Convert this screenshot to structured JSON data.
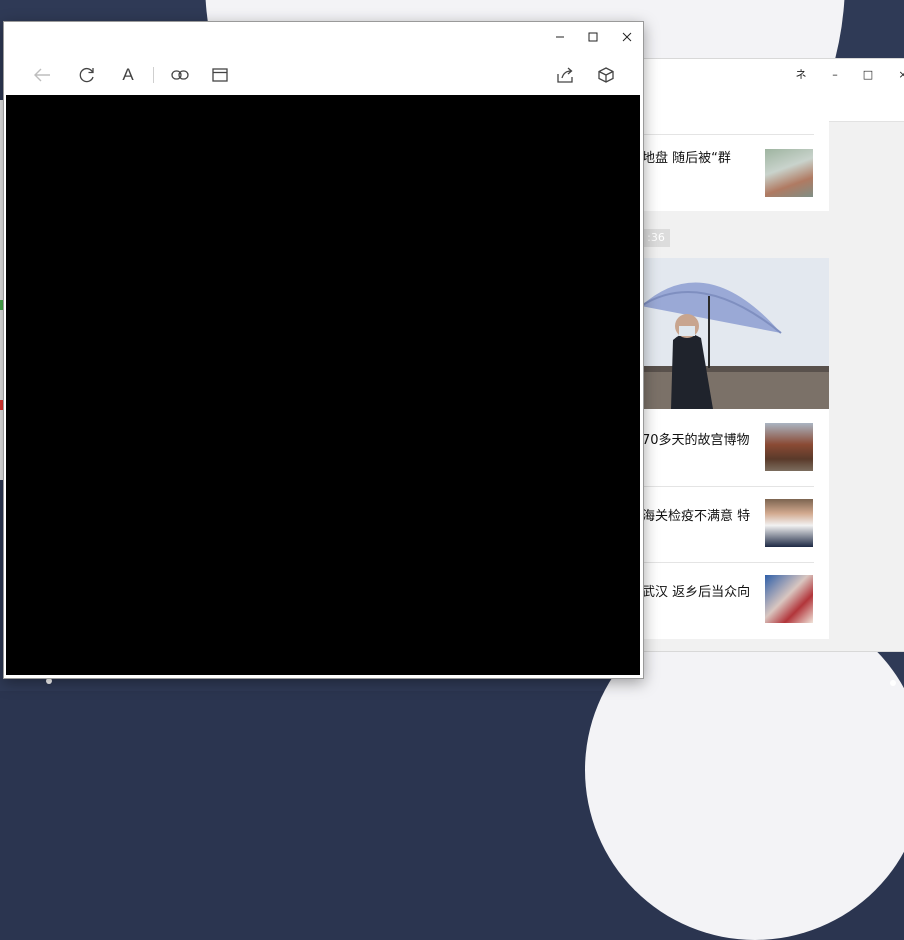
{
  "news_window": {
    "controls": {
      "pin": "ネ",
      "minimize": "–",
      "maximize": "□",
      "close": "×"
    },
    "items": [
      {
        "title": "地盘 随后被“群",
        "thumb": "swan-photo"
      },
      {
        "title": "70多天的故宫博物",
        "thumb": "palace-photo"
      },
      {
        "title": "海关检疫不满意 特",
        "thumb": "doctor-photo"
      },
      {
        "title": "武汉 返乡后当众向",
        "thumb": "people-photo"
      }
    ],
    "hero_time": ":36",
    "hero_caption": "umbrella-photo"
  },
  "browser": {
    "caption": {
      "minimize": "minimize",
      "maximize": "maximize",
      "close": "close"
    },
    "toolbar": {
      "back": "back-arrow-icon",
      "refresh": "refresh-icon",
      "font": "A",
      "link": "link-icon",
      "window": "window-icon",
      "share": "share-icon",
      "box": "3d-box-icon"
    }
  }
}
